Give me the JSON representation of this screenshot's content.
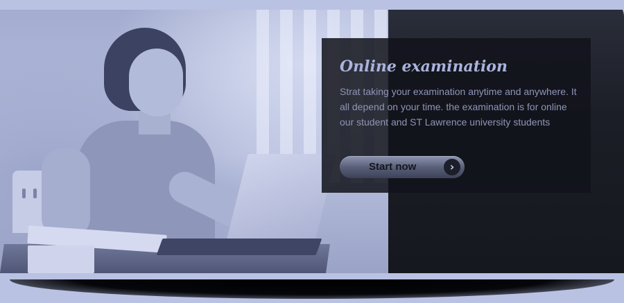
{
  "banner": {
    "title": "Online examination",
    "description": "Strat taking your examination anytime and anywhere. It all depend on your time. the examination is for online our student and ST Lawrence university students",
    "button_label": "Start now",
    "button_icon": "chevron-right-icon"
  },
  "colors": {
    "page_background": "#b9c2e3",
    "overlay_background": "#11131b",
    "title_color": "#aab3db",
    "text_color": "#8f96b6",
    "button_text": "#14161d"
  }
}
